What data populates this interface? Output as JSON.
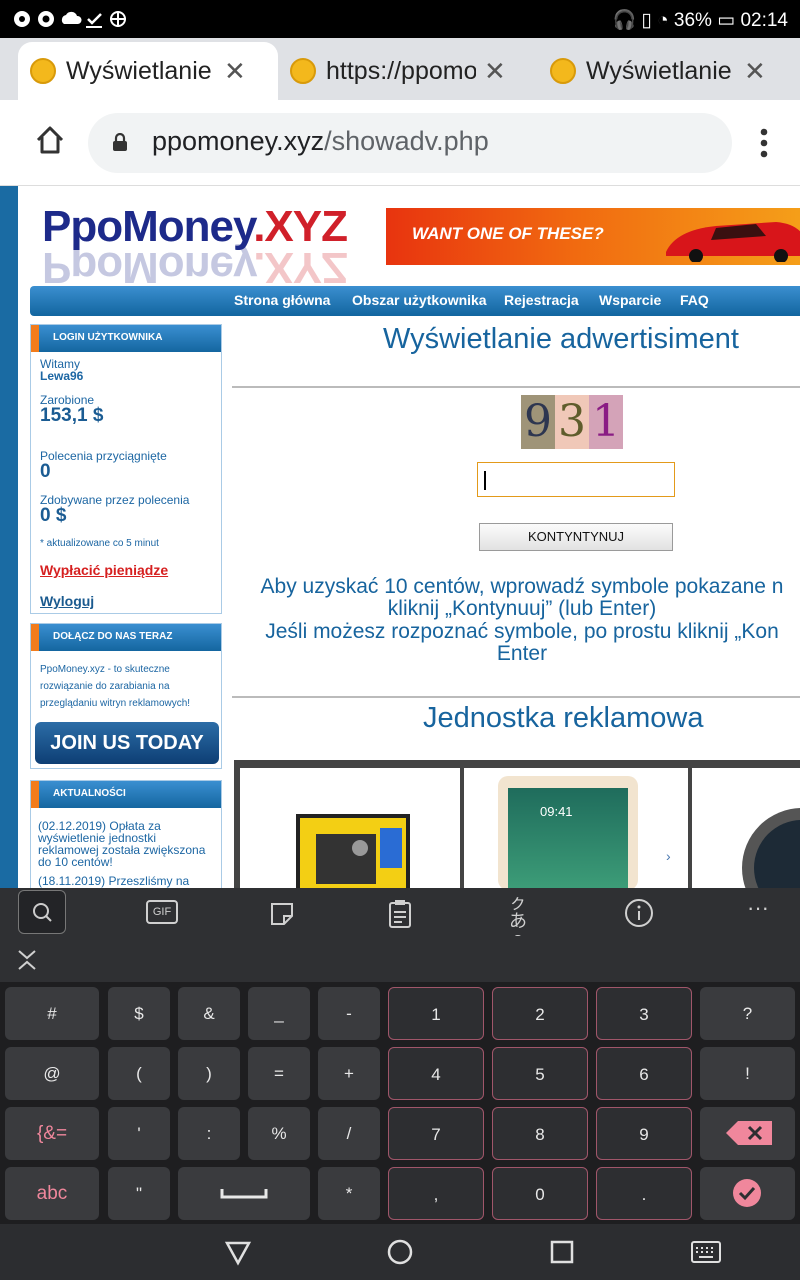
{
  "status_bar": {
    "battery": "36%",
    "time": "02:14"
  },
  "tabs": [
    {
      "label": "Wyświetlanie p"
    },
    {
      "label": "https://ppomo"
    },
    {
      "label": "Wyświetlanie p"
    }
  ],
  "address_bar": {
    "domain": "ppomoney.xyz",
    "path": "/showadv.php"
  },
  "page": {
    "logo": {
      "part1": "PpoMoney",
      "part2": ".XYZ"
    },
    "banner_text": "WANT ONE OF THESE?",
    "nav": [
      "Strona główna",
      "Obszar użytkownika",
      "Rejestracja",
      "Wsparcie",
      "FAQ"
    ],
    "login_box": {
      "header": "LOGIN UŻYTKOWNIKA",
      "welcome": "Witamy",
      "username": "Lewa96",
      "earned_label": "Zarobione",
      "earned_value": "153,1 $",
      "referrals_label": "Polecenia przyciągnięte",
      "referrals_value": "0",
      "ref_earned_label": "Zdobywane przez polecenia",
      "ref_earned_value": "0 $",
      "update_note": "* aktualizowane co 5 minut",
      "withdraw": "Wypłacić pieniądze",
      "logout": "Wyloguj"
    },
    "join_box": {
      "header": "DOŁĄCZ DO NAS TERAZ",
      "text1": "PpoMoney.xyz - to skuteczne",
      "text2": "rozwiązanie do zarabiania na",
      "text3": "przeglądaniu witryn reklamowych!",
      "button": "JOIN US TODAY"
    },
    "news_box": {
      "header": "AKTUALNOŚCI",
      "item1_l1": "(02.12.2019) Opłata za",
      "item1_l2": "wyświetlenie jednostki",
      "item1_l3": "reklamowej została zwiększona",
      "item1_l4": "do 10 centów!",
      "item2_l1": "(18.11.2019) Przeszliśmy na"
    },
    "main_title": "Wyświetlanie adwertisiment",
    "captcha": [
      "9",
      "3",
      "1"
    ],
    "continue_button": "KONTYNTYNUJ",
    "instr1": "Aby uzyskać 10 centów, wprowadź symbole pokazane n",
    "instr2": "kliknij „Kontynuuj” (lub Enter)",
    "instr3": "Jeśli możesz rozpoznać symbole, po prostu kliknij „Kon",
    "instr4": "Enter",
    "ad_title": "Jednostka reklamowa",
    "ad_tablet_time": "09:41"
  },
  "keyboard": {
    "toolbar": [
      "search-icon",
      "gif-icon",
      "sticker-icon",
      "clipboard-icon",
      "translate-icon",
      "info-icon",
      "more-icon"
    ],
    "gif_label": "GIF",
    "more_label": "···",
    "rows": [
      [
        "#",
        "$",
        "&",
        "_",
        "-",
        "1",
        "2",
        "3",
        "?"
      ],
      [
        "@",
        "(",
        ")",
        "=",
        "+",
        "4",
        "5",
        "6",
        "!"
      ],
      [
        "{&=",
        "'",
        ":",
        "%",
        "/",
        "7",
        "8",
        "9",
        ""
      ],
      [
        "abc",
        "\"",
        "",
        "*",
        ",",
        "0",
        ".",
        ""
      ]
    ]
  }
}
